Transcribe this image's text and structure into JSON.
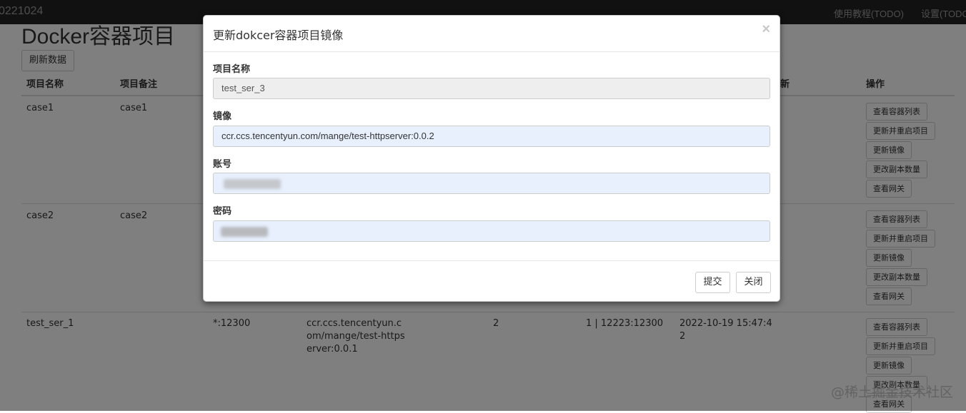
{
  "navbar": {
    "brand": "0221024",
    "links": [
      "使用教程(TODO)",
      "设置(TODO"
    ]
  },
  "page": {
    "title": "Docker容器项目",
    "refresh_label": "刷新数据"
  },
  "table": {
    "headers": [
      "项目名称",
      "项目备注",
      "新",
      "操作"
    ],
    "rows": [
      {
        "name": "case1",
        "note": "case1",
        "actions": [
          "查看容器列表",
          "更新并重启项目",
          "更新镜像",
          "更改副本数量",
          "查看网关"
        ]
      },
      {
        "name": "case2",
        "note": "case2",
        "actions": [
          "查看容器列表",
          "更新并重启项目",
          "更新镜像",
          "更改副本数量",
          "查看网关"
        ]
      },
      {
        "name": "test_ser_1",
        "note": "",
        "port": "*:12300",
        "image_lines": [
          "ccr.ccs.tencentyun.c",
          "om/mange/test-https",
          "erver:0.0.1"
        ],
        "replicas": "2",
        "gateway": "1 | 12223:12300",
        "updated_lines": [
          "2022-10-19 15:47:4",
          "2"
        ],
        "actions": [
          "查看容器列表",
          "更新并重启项目",
          "更新镜像",
          "更改副本数量",
          "查看网关"
        ]
      }
    ]
  },
  "modal": {
    "title": "更新dokcer容器项目镜像",
    "close_symbol": "×",
    "fields": {
      "project_name": {
        "label": "项目名称",
        "value": "test_ser_3"
      },
      "image": {
        "label": "镜像",
        "value": "ccr.ccs.tencentyun.com/mange/test-httpserver:0.0.2"
      },
      "account": {
        "label": "账号",
        "value": ""
      },
      "password": {
        "label": "密码",
        "value": ""
      }
    },
    "submit_label": "提交",
    "close_label": "关闭"
  },
  "watermark": "@稀土掘金技术社区",
  "colors": {
    "navbar_bg": "#222222",
    "autofill_bg": "#e8f0fe",
    "disabled_bg": "#eeeeee",
    "backdrop": "rgba(0,0,0,0.5)"
  }
}
